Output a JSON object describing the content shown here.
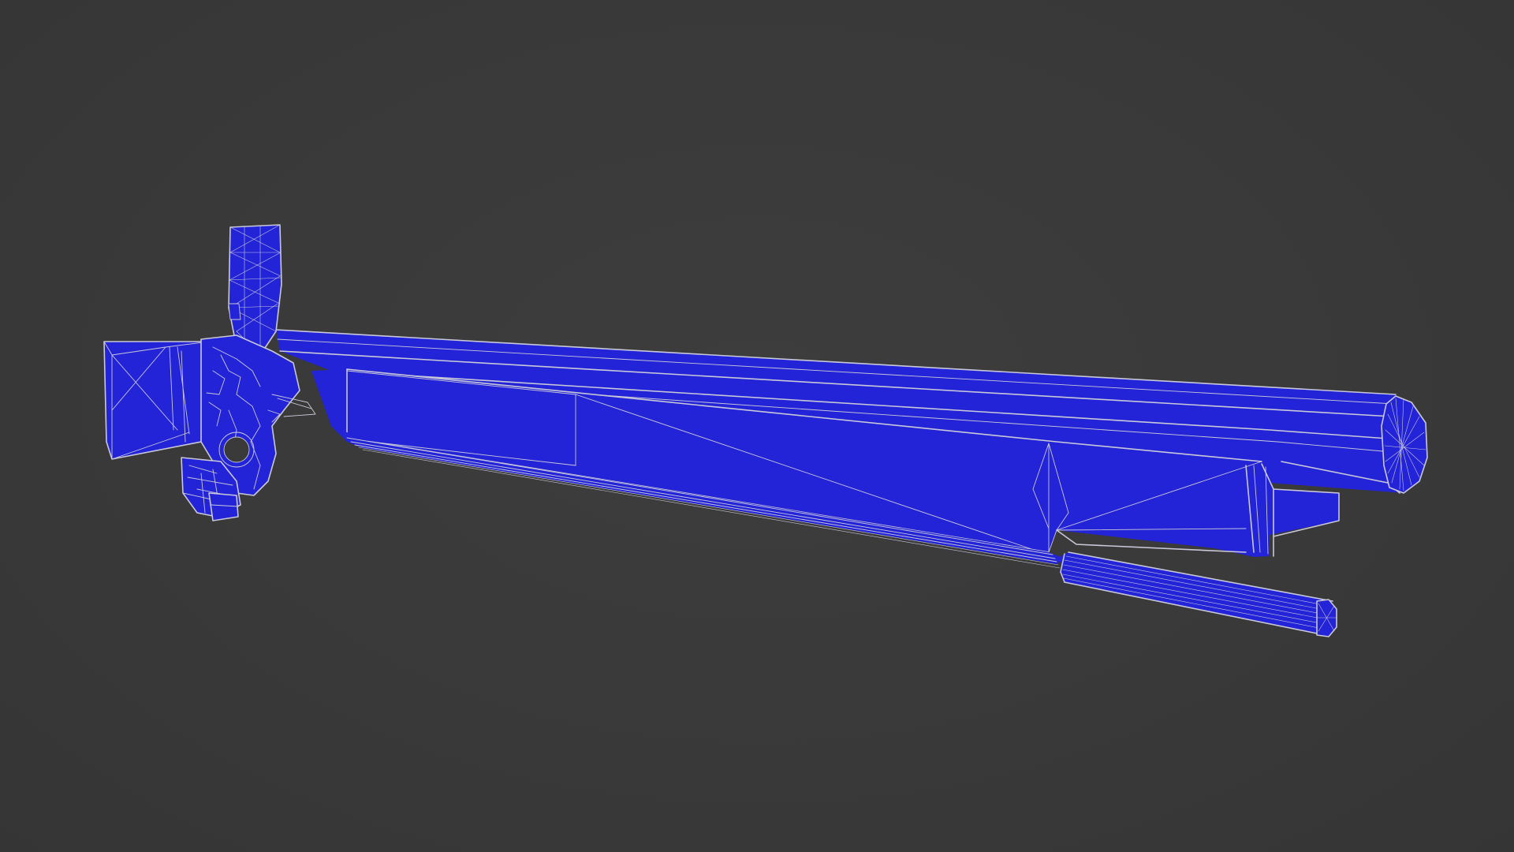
{
  "viewport": {
    "background": "#3a3a3a",
    "model_fill": "#2323d8",
    "wire_color": "#c8c8d8",
    "shading": "wireframe-over-solid"
  }
}
